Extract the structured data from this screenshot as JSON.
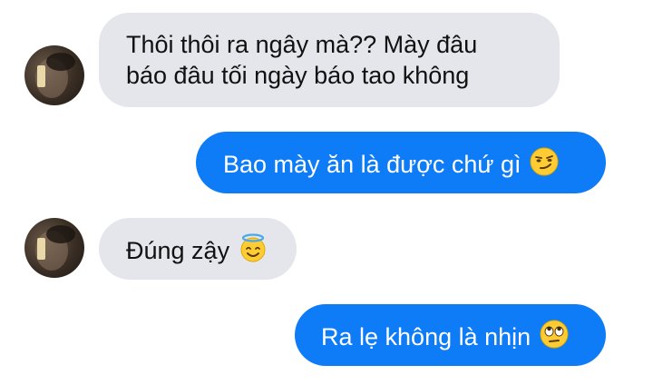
{
  "messages": [
    {
      "sender": "other",
      "line1": "Thôi thôi ra ngây mà?? Mày đâu",
      "line2": "báo đâu tối ngày báo tao không"
    },
    {
      "sender": "me",
      "text": "Bao mày ăn là được chứ gì",
      "emoji": "smirking-face-emoji"
    },
    {
      "sender": "other",
      "text": "Đúng zậy",
      "emoji": "smiling-face-with-halo-emoji"
    },
    {
      "sender": "me",
      "text": "Ra lẹ không là nhịn",
      "emoji": "face-with-rolling-eyes-emoji"
    }
  ],
  "colors": {
    "incoming_bubble": "#e4e6eb",
    "outgoing_bubble": "#0e7bf7",
    "outgoing_text": "#ffffff",
    "incoming_text": "#111111"
  }
}
